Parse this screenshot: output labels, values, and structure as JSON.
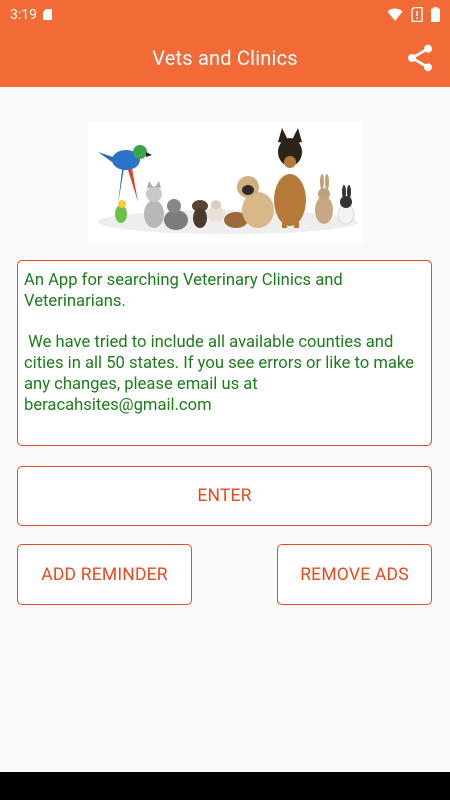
{
  "status_bar": {
    "time": "3:19",
    "icons": [
      "sd-card-icon",
      "wifi-icon",
      "no-sim-icon",
      "battery-icon"
    ]
  },
  "app_bar": {
    "title": "Vets and Clinics",
    "share_icon": "share-icon"
  },
  "hero_image": {
    "description_icon": "pets-banner-image"
  },
  "description": {
    "text": "An App for searching Veterinary Clinics and Veterinarians.\n\n We have tried to include all available counties and cities in all 50 states. If you see errors or like to make any changes, please email us at beracahsites@gmail.com"
  },
  "buttons": {
    "enter": "ENTER",
    "add_reminder": "ADD REMINDER",
    "remove_ads": "REMOVE ADS"
  },
  "colors": {
    "primary": "#f26a36",
    "accent": "#e8491d",
    "text_green": "#1c7d1c",
    "background": "#fafafa"
  }
}
